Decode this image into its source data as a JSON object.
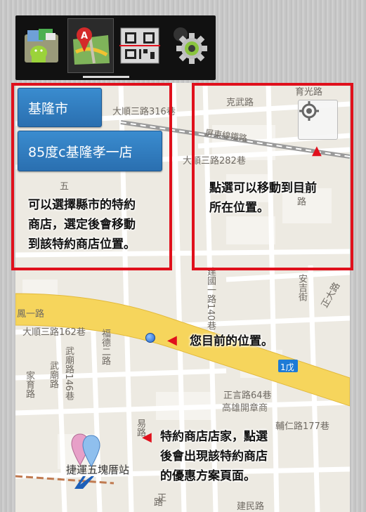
{
  "tabs": [
    {
      "icon": "android-bag-icon"
    },
    {
      "icon": "map-pin-icon"
    },
    {
      "icon": "barcode-scanner-icon"
    },
    {
      "icon": "gear-icon"
    }
  ],
  "city_selector": {
    "value": "基隆市"
  },
  "store_selector": {
    "value": "85度c基隆孝一店"
  },
  "annotations": {
    "select_hint": "可以選擇縣市的特約\n商店，選定後會移動\n到該特約商店位置。",
    "locate_hint": "點選可以移動到目前\n所在位置。",
    "current_location_hint": "您目前的位置。",
    "store_pin_hint": "特約商店店家，點選\n後會出現該特約商店\n的優惠方案頁面。"
  },
  "map_labels": {
    "l1": "大順三路316巷",
    "l2": "克武路",
    "l3": "育光路",
    "l4": "屏東線鐵路",
    "l5": "大順三路282巷",
    "l6": "五",
    "l7": "正",
    "l8": "路",
    "l9": "鳳一路",
    "l10": "大順三路162巷",
    "l11": "武廟路146巷",
    "l12": "福德二路",
    "l13": "建國一路140巷",
    "l14": "安吉街",
    "l15": "正大路",
    "l16": "正言路64巷",
    "l17": "高雄開章商",
    "l18": "輔仁路177巷",
    "l19": "武廟路",
    "l20": "家育路",
    "l21": "捷運五塊厝站",
    "l22": "建民路",
    "l23": "1戊",
    "l24": "易路",
    "l25": "路",
    "l26": "正"
  },
  "colors": {
    "annotation_red": "#e0101c",
    "button_blue": "#2a6fb0"
  }
}
